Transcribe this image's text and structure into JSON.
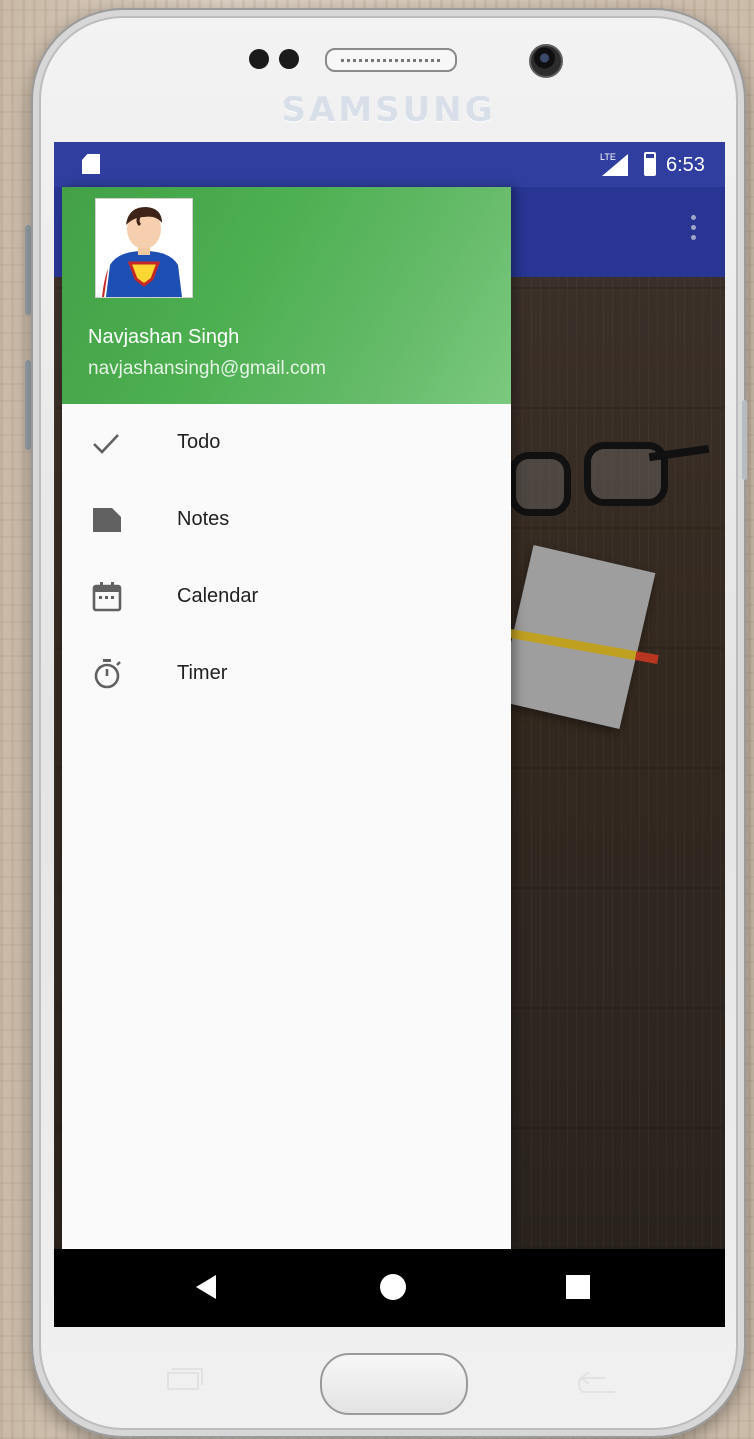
{
  "device": {
    "brand": "SAMSUNG"
  },
  "status_bar": {
    "time": "6:53",
    "network": "LTE"
  },
  "drawer": {
    "user": {
      "name": "Navjashan Singh",
      "email": "navjashansingh@gmail.com"
    },
    "items": [
      {
        "label": "Todo",
        "icon": "checkmark-icon"
      },
      {
        "label": "Notes",
        "icon": "note-icon"
      },
      {
        "label": "Calendar",
        "icon": "calendar-icon"
      },
      {
        "label": "Timer",
        "icon": "timer-icon"
      }
    ]
  },
  "colors": {
    "status_bar": "#303f9f",
    "app_bar": "#283593",
    "drawer_header": "#4caf50"
  }
}
